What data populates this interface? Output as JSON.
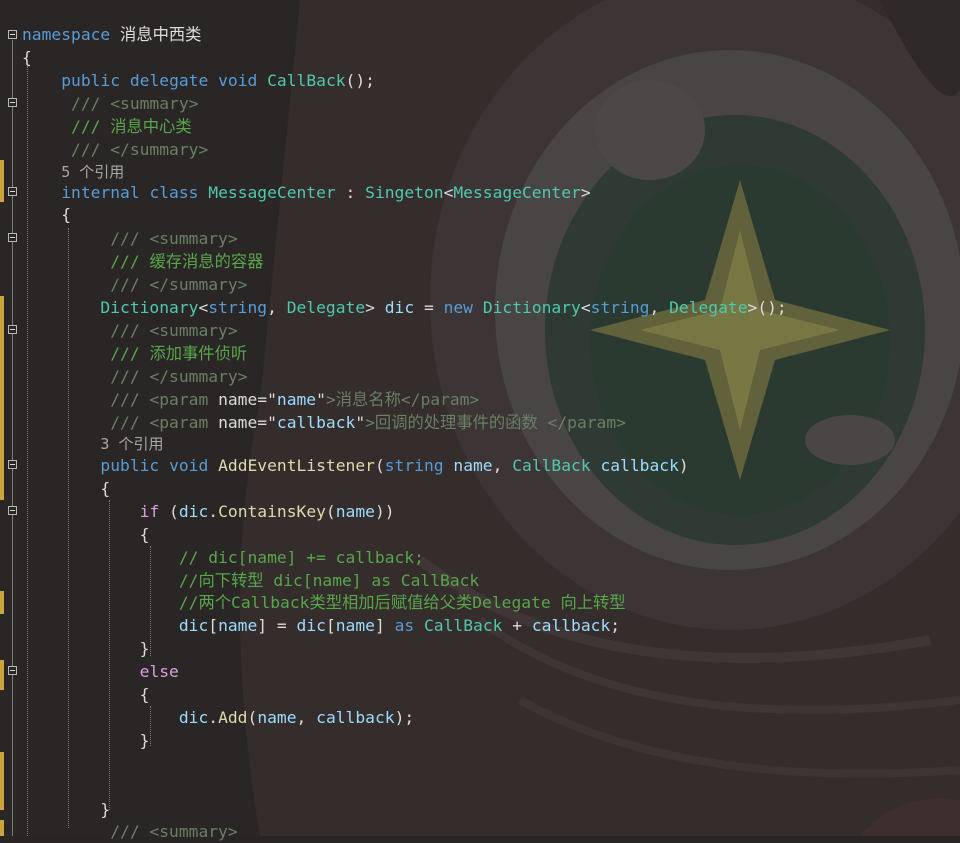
{
  "editor": {
    "language": "C#",
    "colors": {
      "keyword": "#569cd6",
      "control_keyword": "#d8a0df",
      "type": "#4ec9b0",
      "method": "#dcdcaa",
      "variable": "#9cdcfe",
      "string": "#d69d85",
      "comment": "#57a64a",
      "doc_comment": "#6a7f63",
      "plain": "#dcdcdc",
      "reference_hint": "#a8a8a8",
      "change_marker": "#c9a53b"
    },
    "background_image": "anime-eye-artwork-dimmed",
    "lines": [
      {
        "tokens": [
          [
            "namespace",
            "kw"
          ],
          [
            " 消息中西类",
            "pun"
          ]
        ]
      },
      {
        "tokens": [
          [
            "{",
            "pun"
          ]
        ]
      },
      {
        "tokens": [
          [
            "    ",
            "pun"
          ],
          [
            "public",
            "kw"
          ],
          [
            " ",
            "pun"
          ],
          [
            "delegate",
            "kw"
          ],
          [
            " ",
            "pun"
          ],
          [
            "void",
            "kw"
          ],
          [
            " ",
            "pun"
          ],
          [
            "CallBack",
            "ty"
          ],
          [
            "();",
            "pun"
          ]
        ]
      },
      {
        "tokens": [
          [
            "     ",
            "pun"
          ],
          [
            "/// <summary>",
            "xml"
          ]
        ]
      },
      {
        "tokens": [
          [
            "     ",
            "pun"
          ],
          [
            "/// 消息中心类",
            "cm"
          ]
        ]
      },
      {
        "tokens": [
          [
            "     ",
            "pun"
          ],
          [
            "/// </summary>",
            "xml"
          ]
        ]
      },
      {
        "ref": true,
        "tokens": [
          [
            "    ",
            "pun"
          ],
          [
            "5 个引用",
            "ref"
          ]
        ]
      },
      {
        "tokens": [
          [
            "    ",
            "pun"
          ],
          [
            "internal",
            "kw"
          ],
          [
            " ",
            "pun"
          ],
          [
            "class",
            "kw"
          ],
          [
            " ",
            "pun"
          ],
          [
            "MessageCenter",
            "ty"
          ],
          [
            " : ",
            "pun"
          ],
          [
            "Singeton",
            "ty"
          ],
          [
            "<",
            "pun"
          ],
          [
            "MessageCenter",
            "ty"
          ],
          [
            ">",
            "pun"
          ]
        ]
      },
      {
        "tokens": [
          [
            "    {",
            "pun"
          ]
        ]
      },
      {
        "tokens": [
          [
            "         ",
            "pun"
          ],
          [
            "/// <summary>",
            "xml"
          ]
        ]
      },
      {
        "tokens": [
          [
            "         ",
            "pun"
          ],
          [
            "/// 缓存消息的容器",
            "cm"
          ]
        ]
      },
      {
        "tokens": [
          [
            "         ",
            "pun"
          ],
          [
            "/// </summary>",
            "xml"
          ]
        ]
      },
      {
        "tokens": [
          [
            "        ",
            "pun"
          ],
          [
            "Dictionary",
            "ty"
          ],
          [
            "<",
            "pun"
          ],
          [
            "string",
            "kw"
          ],
          [
            ", ",
            "pun"
          ],
          [
            "Delegate",
            "ty"
          ],
          [
            "> ",
            "pun"
          ],
          [
            "dic",
            "var"
          ],
          [
            " = ",
            "pun"
          ],
          [
            "new",
            "kw"
          ],
          [
            " ",
            "pun"
          ],
          [
            "Dictionary",
            "ty"
          ],
          [
            "<",
            "pun"
          ],
          [
            "string",
            "kw"
          ],
          [
            ", ",
            "pun"
          ],
          [
            "Delegate",
            "ty"
          ],
          [
            ">();",
            "pun"
          ]
        ]
      },
      {
        "tokens": [
          [
            "         ",
            "pun"
          ],
          [
            "/// <summary>",
            "xml"
          ]
        ]
      },
      {
        "tokens": [
          [
            "         ",
            "pun"
          ],
          [
            "/// 添加事件侦听",
            "cm"
          ]
        ]
      },
      {
        "tokens": [
          [
            "         ",
            "pun"
          ],
          [
            "/// </summary>",
            "xml"
          ]
        ]
      },
      {
        "tokens": [
          [
            "         ",
            "pun"
          ],
          [
            "/// <param ",
            "xml"
          ],
          [
            "name=\"",
            "pun"
          ],
          [
            "name",
            "var"
          ],
          [
            "\"",
            "pun"
          ],
          [
            ">消息名称</param>",
            "xml"
          ]
        ]
      },
      {
        "tokens": [
          [
            "         ",
            "pun"
          ],
          [
            "/// <param ",
            "xml"
          ],
          [
            "name=\"",
            "pun"
          ],
          [
            "callback",
            "var"
          ],
          [
            "\"",
            "pun"
          ],
          [
            ">回调的处理事件的函数 </param>",
            "xml"
          ]
        ]
      },
      {
        "ref": true,
        "tokens": [
          [
            "        ",
            "pun"
          ],
          [
            "3 个引用",
            "ref"
          ]
        ]
      },
      {
        "tokens": [
          [
            "        ",
            "pun"
          ],
          [
            "public",
            "kw"
          ],
          [
            " ",
            "pun"
          ],
          [
            "void",
            "kw"
          ],
          [
            " ",
            "pun"
          ],
          [
            "AddEventListener",
            "fn"
          ],
          [
            "(",
            "pun"
          ],
          [
            "string",
            "kw"
          ],
          [
            " ",
            "pun"
          ],
          [
            "name",
            "var"
          ],
          [
            ", ",
            "pun"
          ],
          [
            "CallBack",
            "ty"
          ],
          [
            " ",
            "pun"
          ],
          [
            "callback",
            "var"
          ],
          [
            ")",
            "pun"
          ]
        ]
      },
      {
        "tokens": [
          [
            "        {",
            "pun"
          ]
        ]
      },
      {
        "tokens": [
          [
            "            ",
            "pun"
          ],
          [
            "if",
            "kw2"
          ],
          [
            " (",
            "pun"
          ],
          [
            "dic",
            "var"
          ],
          [
            ".",
            "pun"
          ],
          [
            "ContainsKey",
            "fn"
          ],
          [
            "(",
            "pun"
          ],
          [
            "name",
            "var"
          ],
          [
            "))",
            "pun"
          ]
        ]
      },
      {
        "tokens": [
          [
            "            {",
            "pun"
          ]
        ]
      },
      {
        "tokens": [
          [
            "                ",
            "pun"
          ],
          [
            "// dic[name] += callback;",
            "cm"
          ]
        ]
      },
      {
        "tokens": [
          [
            "                ",
            "pun"
          ],
          [
            "//向下转型 dic[name] as CallBack",
            "cm"
          ]
        ]
      },
      {
        "tokens": [
          [
            "                ",
            "pun"
          ],
          [
            "//两个Callback类型相加后赋值给父类Delegate 向上转型",
            "cm"
          ]
        ]
      },
      {
        "tokens": [
          [
            "                ",
            "pun"
          ],
          [
            "dic",
            "var"
          ],
          [
            "[",
            "pun"
          ],
          [
            "name",
            "var"
          ],
          [
            "] = ",
            "pun"
          ],
          [
            "dic",
            "var"
          ],
          [
            "[",
            "pun"
          ],
          [
            "name",
            "var"
          ],
          [
            "] ",
            "pun"
          ],
          [
            "as",
            "kw"
          ],
          [
            " ",
            "pun"
          ],
          [
            "CallBack",
            "ty"
          ],
          [
            " + ",
            "pun"
          ],
          [
            "callback",
            "var"
          ],
          [
            ";",
            "pun"
          ]
        ]
      },
      {
        "tokens": [
          [
            "            }",
            "pun"
          ]
        ]
      },
      {
        "tokens": [
          [
            "            ",
            "pun"
          ],
          [
            "else",
            "kw2"
          ]
        ]
      },
      {
        "tokens": [
          [
            "            {",
            "pun"
          ]
        ]
      },
      {
        "tokens": [
          [
            "                ",
            "pun"
          ],
          [
            "dic",
            "var"
          ],
          [
            ".",
            "pun"
          ],
          [
            "Add",
            "fn"
          ],
          [
            "(",
            "pun"
          ],
          [
            "name",
            "var"
          ],
          [
            ", ",
            "pun"
          ],
          [
            "callback",
            "var"
          ],
          [
            ");",
            "pun"
          ]
        ]
      },
      {
        "tokens": [
          [
            "            }",
            "pun"
          ]
        ]
      },
      {
        "tokens": [
          [
            "",
            "pun"
          ]
        ]
      },
      {
        "tokens": [
          [
            "",
            "pun"
          ]
        ]
      },
      {
        "tokens": [
          [
            "        }",
            "pun"
          ]
        ]
      },
      {
        "tokens": [
          [
            "         ",
            "pun"
          ],
          [
            "/// <summary>",
            "xml"
          ]
        ]
      }
    ]
  }
}
